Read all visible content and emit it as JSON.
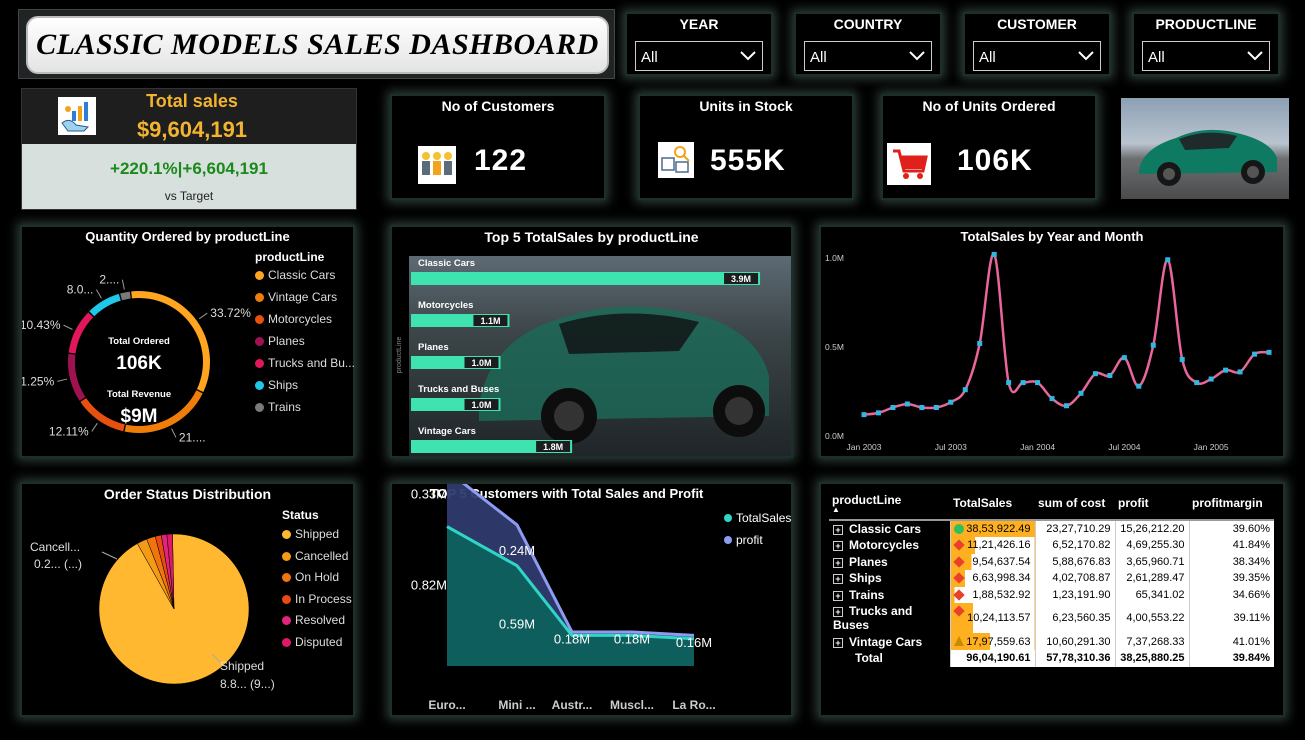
{
  "header": {
    "title": "CLASSIC MODELS SALES DASHBOARD"
  },
  "filters": [
    {
      "label": "YEAR",
      "value": "All"
    },
    {
      "label": "COUNTRY",
      "value": "All"
    },
    {
      "label": "CUSTOMER",
      "value": "All"
    },
    {
      "label": "PRODUCTLINE",
      "value": "All"
    }
  ],
  "kpi": {
    "total_sales": {
      "label": "Total sales",
      "value": "$9,604,191",
      "delta": "+220.1%|+6,604,191",
      "sub": "vs Target"
    },
    "customers": {
      "label": "No of Customers",
      "value": "122"
    },
    "stock": {
      "label": "Units in Stock",
      "value": "555K"
    },
    "ordered": {
      "label": "No of Units Ordered",
      "value": "106K"
    }
  },
  "colors": {
    "accent": "#3fe3b0",
    "line": "#e8669a",
    "marker": "#2fb9e0",
    "gold": "#ffb830"
  },
  "chart_data": [
    {
      "id": "quantity_donut",
      "type": "pie",
      "title": "Quantity Ordered by productLine",
      "legend_title": "productLine",
      "center": {
        "label1": "Total Ordered",
        "value1": "106K",
        "label2": "Total Revenue",
        "value2": "$9M"
      },
      "categories": [
        "Classic Cars",
        "Vintage Cars",
        "Motorcycles",
        "Planes",
        "Trucks and Bu...",
        "Ships",
        "Trains"
      ],
      "values": [
        33.72,
        21.1,
        12.11,
        11.25,
        10.43,
        8.0,
        2.5
      ],
      "labels": [
        "33.72%",
        "21....",
        "12.11%",
        "11.25%",
        "10.43%",
        "8.0...",
        "2...."
      ],
      "colors": [
        "#ffa51f",
        "#f07d0a",
        "#e8500e",
        "#a0124f",
        "#e0185a",
        "#1fc8e8",
        "#7a7a7a"
      ],
      "legend": "right"
    },
    {
      "id": "top5_bar",
      "type": "bar",
      "title": "Top 5 TotalSales by productLine",
      "ylabel": "productLine",
      "categories": [
        "Classic Cars",
        "Motorcycles",
        "Planes",
        "Trucks and Buses",
        "Vintage Cars"
      ],
      "values": [
        3.9,
        1.1,
        1.0,
        1.0,
        1.8
      ],
      "labels": [
        "3.9M",
        "1.1M",
        "1.0M",
        "1.0M",
        "1.8M"
      ],
      "xlim": [
        0,
        4.0
      ]
    },
    {
      "id": "sales_trend",
      "type": "line",
      "title": "TotalSales by Year and Month",
      "x": [
        "2003-01",
        "2003-02",
        "2003-03",
        "2003-04",
        "2003-05",
        "2003-06",
        "2003-07",
        "2003-08",
        "2003-09",
        "2003-10",
        "2003-11",
        "2003-12",
        "2004-01",
        "2004-02",
        "2004-03",
        "2004-04",
        "2004-05",
        "2004-06",
        "2004-07",
        "2004-08",
        "2004-09",
        "2004-10",
        "2004-11",
        "2004-12",
        "2005-01",
        "2005-02",
        "2005-03",
        "2005-04",
        "2005-05"
      ],
      "values": [
        0.12,
        0.13,
        0.16,
        0.18,
        0.16,
        0.16,
        0.19,
        0.26,
        0.52,
        1.02,
        0.3,
        0.3,
        0.3,
        0.21,
        0.17,
        0.24,
        0.35,
        0.34,
        0.44,
        0.28,
        0.51,
        0.99,
        0.43,
        0.3,
        0.32,
        0.37,
        0.36,
        0.46,
        0.47
      ],
      "x_ticks": [
        {
          "label": "Jan 2003",
          "x": "2003-01"
        },
        {
          "label": "Jul 2003",
          "x": "2003-07"
        },
        {
          "label": "Jan 2004",
          "x": "2004-01"
        },
        {
          "label": "Jul 2004",
          "x": "2004-07"
        },
        {
          "label": "Jan 2005",
          "x": "2005-01"
        }
      ],
      "y_ticks": [
        "0.0M",
        "0.5M",
        "1.0M"
      ],
      "ylim": [
        0,
        1.0
      ]
    },
    {
      "id": "order_status",
      "type": "pie",
      "title": "Order Status Distribution",
      "legend_title": "Status",
      "categories": [
        "Shipped",
        "Cancelled",
        "On Hold",
        "In Process",
        "Resolved",
        "Disputed"
      ],
      "values": [
        92.2,
        2.2,
        1.9,
        1.3,
        1.2,
        1.2
      ],
      "colors": [
        "#ffb830",
        "#f59a14",
        "#f0750f",
        "#e84a10",
        "#e0267a",
        "#e0186a"
      ],
      "slice_labels": [
        {
          "line1": "Shipped",
          "line2": "8.8... (9...)"
        },
        {
          "line1": "Cancell...",
          "line2": "0.2... (...)"
        }
      ],
      "legend": "right"
    },
    {
      "id": "top_customers",
      "type": "area",
      "title": "TOP 5 Customers with Total Sales and Profit",
      "categories": [
        "Euro...",
        "Mini ...",
        "Austr...",
        "Muscl...",
        "La Ro..."
      ],
      "series": [
        {
          "name": "TotalSales",
          "values": [
            0.82,
            0.59,
            0.18,
            0.18,
            0.16
          ],
          "labels": [
            "0.82M",
            "0.59M",
            "0.18M",
            "0.18M",
            "0.16M"
          ],
          "color": "#2fd6c6"
        },
        {
          "name": "profit",
          "values": [
            0.33,
            0.24,
            0.02,
            0.02,
            0.02
          ],
          "labels": [
            "0.33M",
            "0.24M"
          ],
          "color": "#8e9cf0"
        }
      ],
      "legend": "top-right"
    },
    {
      "id": "profit_table",
      "type": "table",
      "columns": [
        "productLine",
        "TotalSales",
        "sum of cost",
        "profit",
        "profitmargin"
      ],
      "rows": [
        [
          "Classic Cars",
          "38,53,922.49",
          "23,27,710.29",
          "15,26,212.20",
          "39.60%"
        ],
        [
          "Motorcycles",
          "11,21,426.16",
          "6,52,170.82",
          "4,69,255.30",
          "41.84%"
        ],
        [
          "Planes",
          "9,54,637.54",
          "5,88,676.83",
          "3,65,960.71",
          "38.34%"
        ],
        [
          "Ships",
          "6,63,998.34",
          "4,02,708.87",
          "2,61,289.47",
          "39.35%"
        ],
        [
          "Trains",
          "1,88,532.92",
          "1,23,191.90",
          "65,341.02",
          "34.66%"
        ],
        [
          "Trucks and Buses",
          "10,24,113.57",
          "6,23,560.35",
          "4,00,553.22",
          "39.11%"
        ],
        [
          "Vintage Cars",
          "17,97,559.63",
          "10,60,291.30",
          "7,37,268.33",
          "41.01%"
        ]
      ],
      "total": [
        "Total",
        "96,04,190.61",
        "57,78,310.36",
        "38,25,880.25",
        "39.84%"
      ],
      "sales_share": [
        1.0,
        0.29,
        0.25,
        0.17,
        0.05,
        0.27,
        0.47
      ],
      "indicators": [
        "circle",
        "diamond",
        "diamond",
        "diamond",
        "diamond",
        "diamond",
        "triangle"
      ]
    }
  ]
}
